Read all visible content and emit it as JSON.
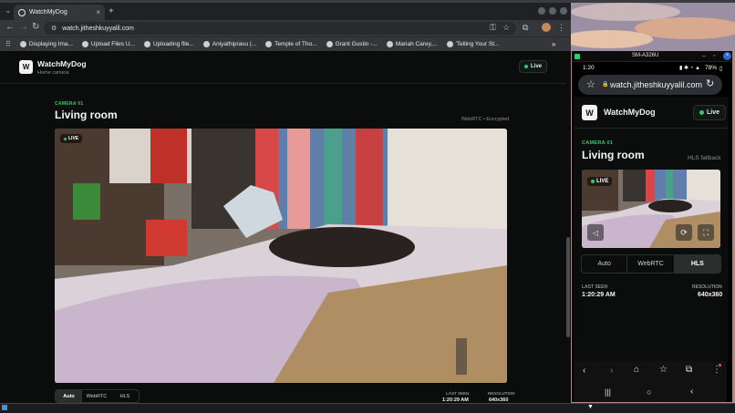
{
  "browser": {
    "tab_title": "WatchMyDog",
    "url": "watch.jitheshkuyyalil.com",
    "bookmarks": [
      "Displaying Ima...",
      "Upload Files U...",
      "Uploading file...",
      "Aniyathipravu |...",
      "Temple of Tho...",
      "Grant Gustin -...",
      "Mariah Carey,...",
      "'Telling Your St..."
    ],
    "new_tab_symbol": "+",
    "overflow_symbol": "»"
  },
  "app": {
    "logo_letter": "W",
    "brand": "WatchMyDog",
    "brand_sub": "Home camera",
    "live_label": "Live",
    "camera_label": "CAMERA 01",
    "camera_name": "Living room",
    "transport": "WebRTC",
    "separator": "•",
    "security": "Encrypted",
    "video_live": "LIVE",
    "modes": [
      "Auto",
      "WebRTC",
      "HLS"
    ],
    "active_mode": "Auto",
    "last_seen_label": "LAST SEEN",
    "last_seen_value": "1:20:29 AM",
    "resolution_label": "RESOLUTION",
    "resolution_value": "640x360"
  },
  "phone": {
    "window_title": "SM-A326U",
    "time": "1:20",
    "battery": "78%",
    "url": "watch.jitheshkuyyalil.com",
    "fallback": "HLS fallback",
    "active_mode": "HLS"
  },
  "colors": {
    "accent_green": "#3ec46d",
    "live_dot": "#2ecc71",
    "page_bg": "#0b0d0d"
  },
  "icons": [
    "site-info-icon",
    "star-icon",
    "reload-icon",
    "back-icon",
    "forward-icon",
    "home-icon",
    "tabs-icon",
    "more-icon",
    "mute-icon",
    "fullscreen-icon"
  ]
}
